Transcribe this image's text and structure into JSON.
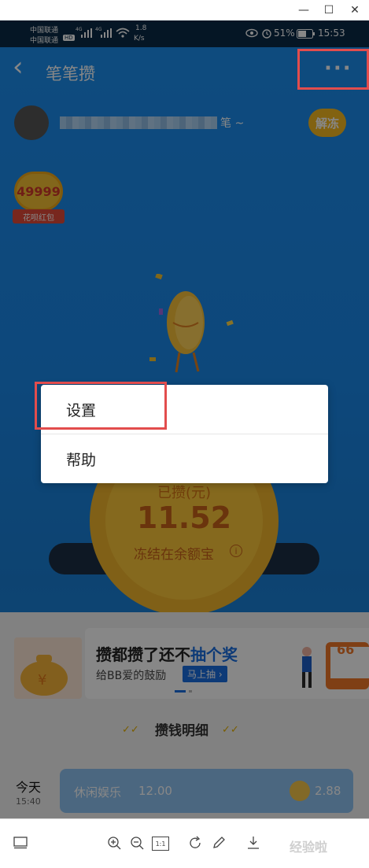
{
  "window": {
    "minimize_glyph": "—",
    "maximize_glyph": "☐",
    "close_glyph": "✕"
  },
  "status_bar": {
    "carrier1": "中国联通",
    "carrier2": "中国联通",
    "hd_badge": "HD",
    "net_type": "4G",
    "speed": "1.8",
    "speed_unit": "K/s",
    "battery": "51%",
    "time": "15:53"
  },
  "app_bar": {
    "title": "笔笔攒",
    "back_glyph": "‹",
    "more_glyph": "···"
  },
  "account": {
    "name_suffix": "笔 ~",
    "unfreeze_label": "解冻"
  },
  "huabei": {
    "amount": "49999",
    "label": "花呗红包"
  },
  "savings": {
    "label": "已攒(元)",
    "amount": "11.52",
    "note": "冻结在余额宝",
    "info_glyph": "i"
  },
  "banner": {
    "title_prefix": "攒都攒了还不",
    "title_highlight": "抽个奖",
    "subtitle": "给BB爱的鼓励",
    "cta": "马上抽 ›",
    "side_number": "66"
  },
  "details": {
    "heading": "攒钱明细"
  },
  "record": {
    "day": "今天",
    "time": "15:40",
    "category": "休闲娱乐",
    "spent": "12.00",
    "saved": "2.88"
  },
  "menu": {
    "items": [
      "设置",
      "帮助"
    ]
  },
  "toolbar": {
    "zoom_ratio": "1:1"
  },
  "watermark": "经验啦"
}
